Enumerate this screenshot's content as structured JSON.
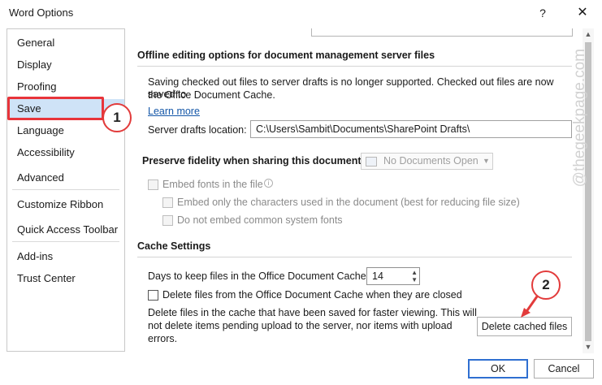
{
  "window": {
    "title": "Word Options",
    "help_glyph": "?",
    "close_glyph": "✕"
  },
  "nav": {
    "items": [
      "General",
      "Display",
      "Proofing",
      "Save",
      "Language",
      "Accessibility",
      "Advanced",
      "Customize Ribbon",
      "Quick Access Toolbar",
      "Add-ins",
      "Trust Center"
    ],
    "selected": "Save"
  },
  "offline": {
    "heading": "Offline editing options for document management server files",
    "desc_line1": "Saving checked out files to server drafts is no longer supported. Checked out files are now saved to",
    "desc_line2": "the Office Document Cache.",
    "learn_more": "Learn more",
    "server_drafts_label": "Server drafts location:",
    "server_drafts_value": "C:\\Users\\Sambit\\Documents\\SharePoint Drafts\\"
  },
  "fidelity": {
    "heading": "Preserve fidelity when sharing this document:",
    "document_dropdown": "No Documents Open",
    "embed_fonts": "Embed fonts in the file",
    "embed_only_used": "Embed only the characters used in the document (best for reducing file size)",
    "do_not_embed_system": "Do not embed common system fonts"
  },
  "cache": {
    "heading": "Cache Settings",
    "days_label": "Days to keep files in the Office Document Cache:",
    "days_value": "14",
    "delete_on_close": "Delete files from the Office Document Cache when they are closed",
    "delete_desc_line1": "Delete files in the cache that have been saved for faster viewing. This will",
    "delete_desc_line2": "not delete items pending upload to the server, nor items with upload",
    "delete_desc_line3": "errors.",
    "delete_button": "Delete cached files"
  },
  "footer": {
    "ok": "OK",
    "cancel": "Cancel"
  },
  "watermark": "@thegeekpage.com",
  "callouts": {
    "one": "1",
    "two": "2"
  },
  "colors": {
    "accent": "#2f6fd1",
    "highlight": "#e8343a",
    "selected_bg": "#cfe3f7",
    "link": "#1457a8"
  }
}
